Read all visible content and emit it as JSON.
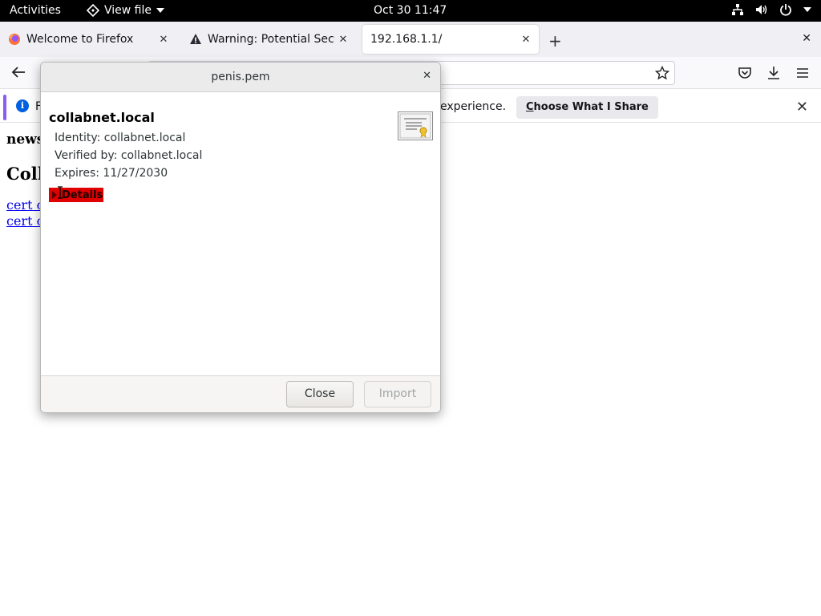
{
  "topbar": {
    "activities": "Activities",
    "app_menu": "View file",
    "clock": "Oct 30  11:47",
    "icons": [
      "network-icon",
      "volume-icon",
      "power-icon",
      "chevron-down-icon"
    ]
  },
  "tabs": [
    {
      "title": "Welcome to Firefox",
      "icon": "firefox-icon",
      "active": false
    },
    {
      "title": "Warning: Potential Securi",
      "icon": "warning-icon",
      "active": false
    },
    {
      "title": "192.168.1.1/",
      "icon": "",
      "active": true
    }
  ],
  "notification": {
    "text_start": "F",
    "text_end": "experience.",
    "button": "Choose What I Share",
    "button_accel": "C"
  },
  "page": {
    "heading_small": "news",
    "heading_big": "Coll",
    "links": [
      "cert c",
      "cert c"
    ]
  },
  "dialog": {
    "title": "penis.pem",
    "common_name": "collabnet.local",
    "identity": "Identity: collabnet.local",
    "verified_by": "Verified by: collabnet.local",
    "expires": "Expires: 11/27/2030",
    "details_label": "Details",
    "close_button": "Close",
    "import_button": "Import"
  },
  "colors": {
    "topbar": "#000000",
    "details_highlight": "#e00000",
    "link": "#0000ee",
    "info_blue": "#0060df"
  }
}
